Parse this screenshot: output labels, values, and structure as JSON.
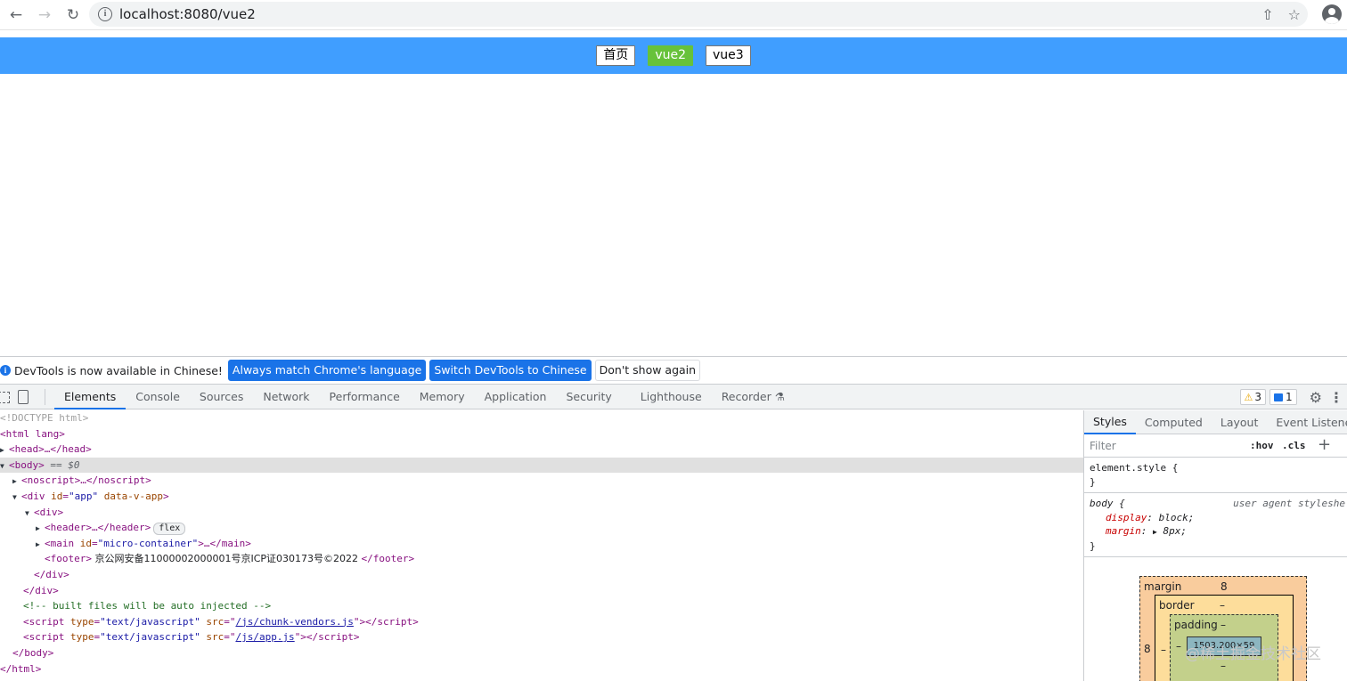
{
  "browser": {
    "url": "localhost:8080/vue2"
  },
  "page": {
    "nav": [
      {
        "label": "首页",
        "active": false
      },
      {
        "label": "vue2",
        "active": true
      },
      {
        "label": "vue3",
        "active": false
      }
    ],
    "colors": {
      "header_bg": "#409eff",
      "active_link_bg": "#67c23a"
    }
  },
  "devtools": {
    "infobar": {
      "message": "DevTools is now available in Chinese!",
      "btn_match": "Always match Chrome's language",
      "btn_switch": "Switch DevTools to Chinese",
      "btn_dont_show": "Don't show again"
    },
    "tabs": [
      "Elements",
      "Console",
      "Sources",
      "Network",
      "Performance",
      "Memory",
      "Application",
      "Security",
      "Lighthouse",
      "Recorder"
    ],
    "warnings_count": "3",
    "messages_count": "1",
    "elements": {
      "doctype": "<!DOCTYPE html>",
      "html_open": "<html lang>",
      "head": "<head>…</head>",
      "body_open": "<body>",
      "body_eq": "== $0",
      "noscript": "<noscript>…</noscript>",
      "div_app_tag": "<div ",
      "div_app_id_attr": "id",
      "div_app_id_val": "\"app\"",
      "div_app_vapp": "data-v-app",
      "div_open": "<div>",
      "header": "<header>…</header>",
      "flex_badge": "flex",
      "main_open": "<main ",
      "main_id_attr": "id",
      "main_id_val": "\"micro-container\"",
      "main_close": ">…</main>",
      "footer_open": "<footer>",
      "footer_text": " 京公网安备11000002000001号京ICP证030173号©2022 ",
      "footer_close": "</footer>",
      "div_close": "</div>",
      "div_app_close": "</div>",
      "comment": "<!-- built files will be auto injected -->",
      "script1_src": "/js/chunk-vendors.js",
      "script2_src": "/js/app.js",
      "script_type_attr": "type",
      "script_type_val": "\"text/javascript\"",
      "script_src_attr": "src",
      "body_close": "</body>",
      "html_close": "</html>"
    },
    "styles": {
      "tabs": [
        "Styles",
        "Computed",
        "Layout",
        "Event Listeners"
      ],
      "filter_placeholder": "Filter",
      "hov": ":hov",
      "cls": ".cls",
      "element_style": "element.style {",
      "close_brace": "}",
      "body_selector": "body {",
      "origin": "user agent styleshe",
      "prop_display": "display",
      "val_display": "block;",
      "prop_margin": "margin",
      "val_margin": "8px;"
    },
    "boxmodel": {
      "margin_label": "margin",
      "margin_top": "8",
      "margin_left": "8",
      "border_label": "border",
      "border_top": "–",
      "padding_label": "padding",
      "padding_top": "–",
      "padding_bottom": "–",
      "padding_left": "–",
      "content": "1503.200×59"
    }
  },
  "watermark": "@稀土掘金技术社区"
}
